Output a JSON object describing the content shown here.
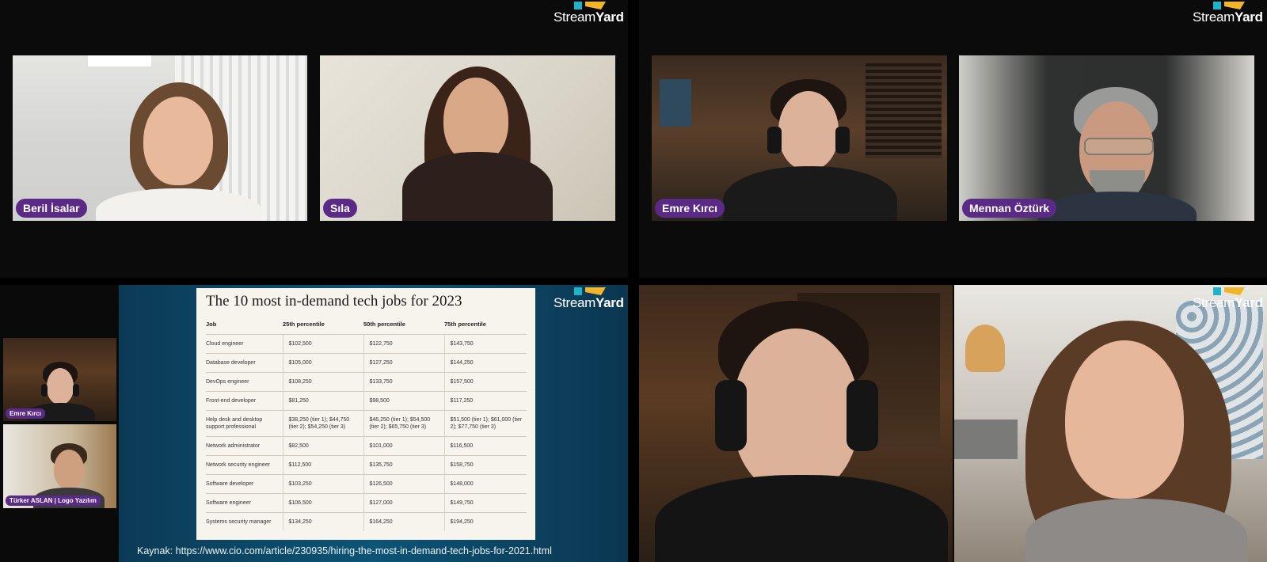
{
  "brand": {
    "logo_prefix": "Stream",
    "logo_suffix": "Yard",
    "accent": "#5b2a86"
  },
  "participants_top_left": [
    {
      "name": "Beril İsalar"
    },
    {
      "name": "Sıla"
    }
  ],
  "participants_top_right": [
    {
      "name": "Emre Kırcı"
    },
    {
      "name": "Mennan Öztürk"
    }
  ],
  "sidebar_cams": [
    {
      "name": "Emre Kırcı"
    },
    {
      "name": "Türker ASLAN | Logo Yazılım"
    }
  ],
  "slide": {
    "title": "The 10 most in-demand tech jobs for 2023",
    "headers": [
      "Job",
      "25th percentile",
      "50th percentile",
      "75th percentile"
    ],
    "rows": [
      [
        "Cloud engineer",
        "$102,500",
        "$122,750",
        "$143,750"
      ],
      [
        "Database developer",
        "$105,000",
        "$127,250",
        "$144,250"
      ],
      [
        "DevOps engineer",
        "$108,250",
        "$133,750",
        "$157,500"
      ],
      [
        "Front-end developer",
        "$81,250",
        "$98,500",
        "$117,250"
      ],
      [
        "Help desk and desktop support professional",
        "$38,250 (tier 1); $44,750 (tier 2); $54,250 (tier 3)",
        "$46,250 (tier 1); $54,500 (tier 2); $65,750 (tier 3)",
        "$51,500 (tier 1); $61,000 (tier 2); $77,750 (tier 3)"
      ],
      [
        "Network administrator",
        "$82,500",
        "$101,000",
        "$116,500"
      ],
      [
        "Network security engineer",
        "$112,500",
        "$135,750",
        "$158,750"
      ],
      [
        "Software developer",
        "$103,250",
        "$126,500",
        "$148,000"
      ],
      [
        "Software engineer",
        "$106,500",
        "$127,000",
        "$149,750"
      ],
      [
        "Systems security manager",
        "$134,250",
        "$164,250",
        "$194,250"
      ]
    ],
    "source": "Kaynak: https://www.cio.com/article/230935/hiring-the-most-in-demand-tech-jobs-for-2021.html"
  },
  "participants_bottom_right": [
    {
      "name": ""
    },
    {
      "name": ""
    }
  ]
}
